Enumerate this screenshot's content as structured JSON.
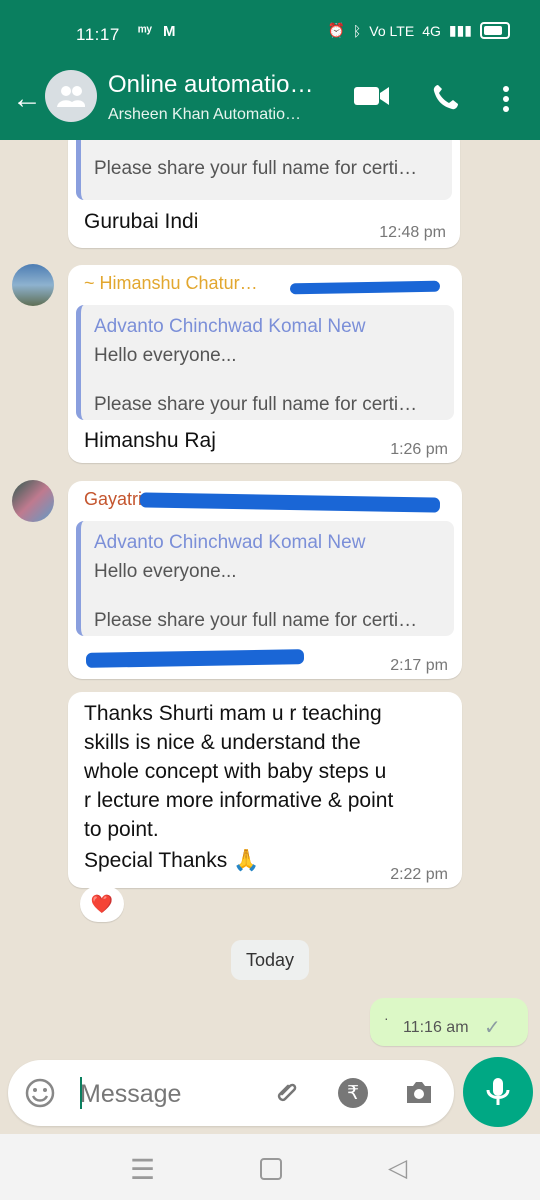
{
  "status": {
    "time": "11:17",
    "icons": [
      "notification-icon",
      "mail-icon",
      "alarm-icon",
      "bluetooth-icon",
      "volte-icon",
      "signal-icon",
      "battery-icon"
    ],
    "network": "4G",
    "volte": "Vo LTE"
  },
  "header": {
    "title": "Online automatio…",
    "subtitle": "Arsheen Khan Automatio…"
  },
  "messages": [
    {
      "quote_last_line": "Please share your full name for certi…",
      "text": "Gurubai  Indi",
      "time": "12:48 pm"
    },
    {
      "sender": "~ Himanshu Chatur…",
      "quote_author": "Advanto Chinchwad Komal New",
      "quote_line1": "Hello everyone...",
      "quote_line2": "Please share your full name for certi…",
      "text": "Himanshu Raj",
      "time": "1:26 pm"
    },
    {
      "sender": "Gayatri",
      "quote_author": "Advanto Chinchwad Komal New",
      "quote_line1": "Hello everyone...",
      "quote_line2": "Please share your full name for certi…",
      "time": "2:17 pm"
    },
    {
      "lines": [
        "Thanks Shurti mam u r teaching",
        "skills is nice & understand the",
        "whole concept with baby steps u",
        "r lecture more informative & point",
        "to point."
      ],
      "special": "Special Thanks 🙏",
      "time": "2:22 pm",
      "reaction": "❤️"
    }
  ],
  "date_divider": "Today",
  "outgoing": {
    "time": "11:16 am",
    "tick": "✓"
  },
  "composer": {
    "placeholder": "Message"
  },
  "colors": {
    "brand": "#0a7f5f",
    "mic": "#00a884",
    "quote_author": "#7b8fd8",
    "himanshu_sender": "#e2a72f",
    "gayatri_sender": "#c4552e"
  }
}
